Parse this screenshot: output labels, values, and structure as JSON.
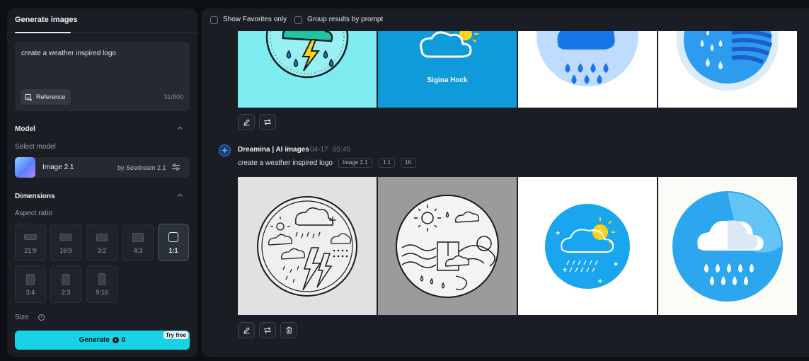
{
  "sidebar": {
    "tab_label": "Generate images",
    "prompt": {
      "value": "create a weather inspired logo",
      "reference_label": "Reference",
      "counter": "31/800"
    },
    "model_section": {
      "title": "Model",
      "select_label": "Select model",
      "model_name": "Image 2.1",
      "model_by": "by Seedream 2.1"
    },
    "dimensions_section": {
      "title": "Dimensions",
      "aspect_label": "Aspect ratio",
      "ratios": [
        "21:9",
        "16:9",
        "3:2",
        "4:3",
        "1:1",
        "3:4",
        "2:3",
        "9:16"
      ],
      "selected_ratio": "1:1"
    },
    "size_label": "Size",
    "generate": {
      "label": "Generate",
      "credits": "0",
      "badge": "Try free"
    }
  },
  "toolbar": {
    "show_favorites_label": "Show Favorites only",
    "group_results_label": "Group results by prompt"
  },
  "results": [
    {
      "images": [
        "weather-logo-storm-cloud-cyan",
        "weather-logo-cloud-sun-blue",
        "weather-logo-rain-cloud-light",
        "weather-logo-rain-wind-blue"
      ],
      "first_image_text": "Sigioa Hock",
      "actions": [
        "edit-icon",
        "regenerate-icon"
      ]
    },
    {
      "author": "Dreamina | AI images",
      "date": "04-17",
      "time": "05:45",
      "prompt": "create a weather inspired logo",
      "tags": [
        "Image 2.1",
        "1:1",
        "1K"
      ],
      "images": [
        "weather-logo-lineart-storm",
        "weather-logo-lineart-sun-waves",
        "weather-logo-cloud-sun-rain",
        "weather-logo-cloud-rain-gradient"
      ],
      "actions": [
        "edit-icon",
        "regenerate-icon",
        "delete-icon"
      ]
    }
  ],
  "colors": {
    "accent": "#19d2e6",
    "panel": "#1a1e24",
    "background": "#0d1014"
  }
}
